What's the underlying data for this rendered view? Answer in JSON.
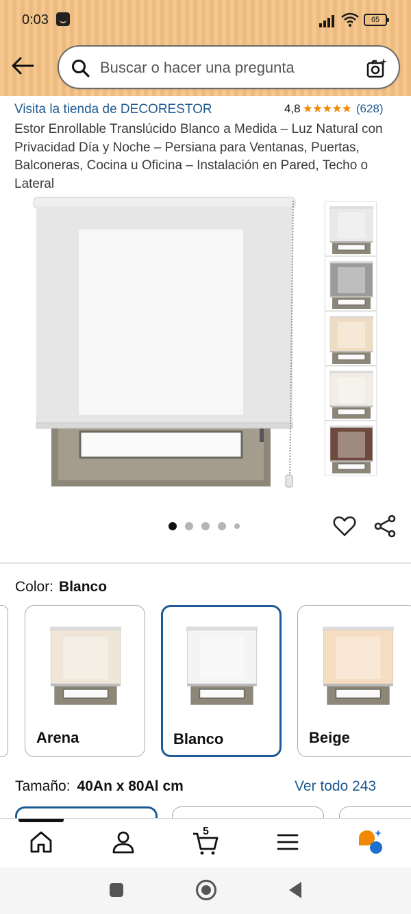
{
  "status_bar": {
    "time": "0:03",
    "battery": "65"
  },
  "search": {
    "placeholder": "Buscar o hacer una pregunta"
  },
  "product": {
    "store_link": "Visita la tienda de DECORESTOR",
    "rating_value": "4,8",
    "stars": "★★★★★",
    "rating_count": "(628)",
    "title": "Estor Enrollable Translúcido Blanco a Medida – Luz Natural con Privacidad Día y Noche – Persiana para Ventanas, Puertas, Balconeras, Cocina u Oficina – Instalación en Pared, Techo o Lateral"
  },
  "gallery": {
    "thumbnail_colors": [
      "#e9e9e9",
      "#9b9b9b",
      "#f0dcc0",
      "#f1ede2",
      "#6e4a3e"
    ],
    "dot_count": 5,
    "active_dot": 0
  },
  "color_selector": {
    "label": "Color:",
    "selected": "Blanco",
    "options": [
      {
        "label": "Arena",
        "color": "#efe6d8"
      },
      {
        "label": "Blanco",
        "color": "#f4f4f4"
      },
      {
        "label": "Beige",
        "color": "#f6dcc0"
      }
    ]
  },
  "size_selector": {
    "label": "Tamaño:",
    "selected": "40An x 80Al cm",
    "see_all": "Ver todo 243"
  },
  "bottom_nav": {
    "cart_count": "5"
  },
  "colors": {
    "link": "#1f5a92",
    "star": "#f08804",
    "selected_border": "#1e5a93",
    "header_bg": "#f3c78f"
  }
}
